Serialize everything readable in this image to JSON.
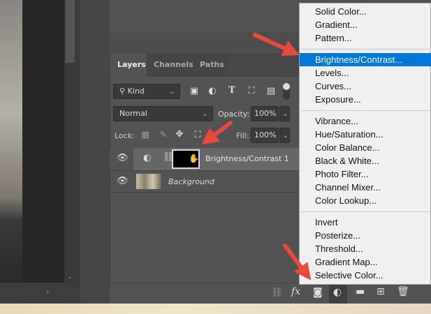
{
  "tabs": [
    "Layers",
    "Channels",
    "Paths"
  ],
  "filter": {
    "label": "Kind"
  },
  "blend_mode": "Normal",
  "opacity": {
    "label": "Opacity:",
    "value": "100%"
  },
  "lock_label": "Lock:",
  "fill": {
    "label": "Fill:",
    "value": "100%"
  },
  "layers": [
    {
      "name": "Brightness/Contrast 1"
    },
    {
      "name": "Background"
    }
  ],
  "menu": {
    "groups": [
      [
        "Solid Color...",
        "Gradient...",
        "Pattern..."
      ],
      [
        "Brightness/Contrast...",
        "Levels...",
        "Curves...",
        "Exposure..."
      ],
      [
        "Vibrance...",
        "Hue/Saturation...",
        "Color Balance...",
        "Black & White...",
        "Photo Filter...",
        "Channel Mixer...",
        "Color Lookup..."
      ],
      [
        "Invert",
        "Posterize...",
        "Threshold...",
        "Gradient Map...",
        "Selective Color..."
      ]
    ],
    "selected": "Brightness/Contrast..."
  },
  "colors": {
    "accent": "#0078d7",
    "arrow": "#e84a3c"
  }
}
